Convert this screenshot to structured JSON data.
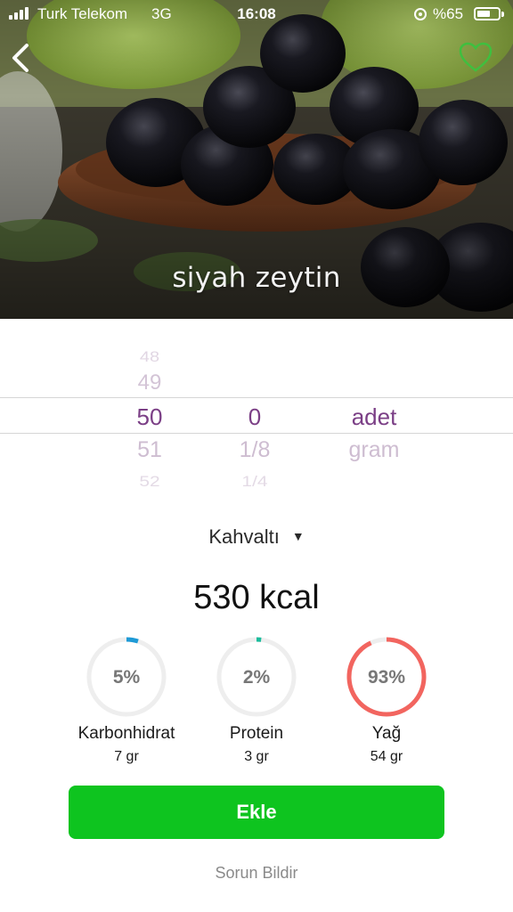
{
  "status_bar": {
    "carrier": "Turk Telekom",
    "network": "3G",
    "time": "16:08",
    "battery": "%65",
    "battery_level": 0.65
  },
  "header": {
    "back_icon": "chevron-left-icon",
    "favorite_icon": "heart-outline-icon",
    "favorite_color": "#3fbf3f",
    "food_name": "siyah zeytin"
  },
  "picker": {
    "numbers": [
      "48",
      "49",
      "50",
      "51",
      "52"
    ],
    "fractions": [
      "",
      "",
      "0",
      "1/8",
      "1/4"
    ],
    "units": [
      "",
      "",
      "adet",
      "gram",
      ""
    ],
    "selected_color": "#7b3f86"
  },
  "meal": {
    "label": "Kahvaltı",
    "arrow": "▼"
  },
  "calories": "530 kcal",
  "macros": [
    {
      "label": "5%",
      "name": "Karbonhidrat",
      "amount": "7 gr",
      "fraction": 0.05,
      "color": "#1e9ad6"
    },
    {
      "label": "2%",
      "name": "Protein",
      "amount": "3 gr",
      "fraction": 0.02,
      "color": "#1abc9c"
    },
    {
      "label": "93%",
      "name": "Yağ",
      "amount": "54 gr",
      "fraction": 0.93,
      "color": "#f2655f"
    }
  ],
  "actions": {
    "add_label": "Ekle",
    "add_color": "#0ec41f",
    "report_label": "Sorun Bildir"
  }
}
